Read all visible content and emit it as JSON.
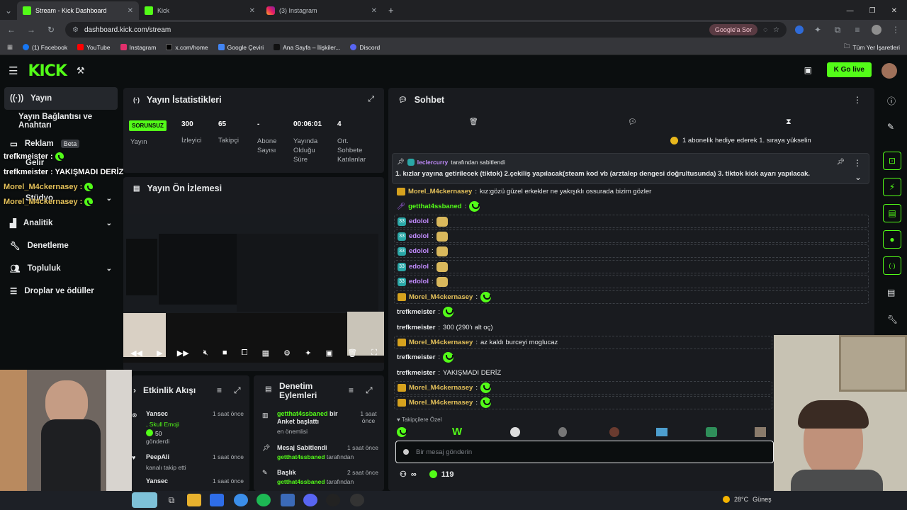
{
  "browser": {
    "tabs": [
      {
        "title": "Stream - Kick Dashboard"
      },
      {
        "title": "Kick"
      },
      {
        "title": "(3) Instagram"
      }
    ],
    "url": "dashboard.kick.com/stream",
    "google_pill": "Google'a Sor",
    "bookmarks": [
      "(1) Facebook",
      "YouTube",
      "Instagram",
      "x.com/home",
      "Google Çeviri",
      "Ana Sayfa – İlişkiler...",
      "Discord"
    ],
    "all_bookmarks": "Tüm Yer İşaretleri"
  },
  "header": {
    "logo": "KICK",
    "go_live": "Go live"
  },
  "sidebar": {
    "items": [
      {
        "label": "Yayın"
      },
      {
        "label": "Yayın Bağlantısı ve Anahtarı"
      },
      {
        "label": "Reklam",
        "badge": "Beta"
      },
      {
        "label": "Gelir"
      },
      {
        "label": "Stüdyo"
      },
      {
        "label": "Analitik"
      },
      {
        "label": "Denetleme"
      },
      {
        "label": "Topluluk"
      },
      {
        "label": "Droplar ve ödüller"
      }
    ],
    "overlay": {
      "line1": "trefkmeister :",
      "line2": "trefkmeister : YAKIŞMADI DERİZ",
      "line3": "Morel_M4ckernasey :",
      "line4": "Morel_M4ckernasey :"
    }
  },
  "stats": {
    "title": "Yayın İstatistikleri",
    "status": "SORUNSUZ",
    "status_label": "Yayın",
    "items": [
      {
        "value": "300",
        "label": "İzleyici"
      },
      {
        "value": "65",
        "label": "Takipçi"
      },
      {
        "value": "-",
        "label": "Abone Sayısı"
      },
      {
        "value": "00:06:01",
        "label": "Yayında Olduğu Süre"
      },
      {
        "value": "4",
        "label": "Ort. Sohbete Katılanlar"
      }
    ]
  },
  "preview": {
    "title": "Yayın Ön İzlemesi"
  },
  "activity": {
    "title": "Etkinlik Akışı",
    "items": [
      {
        "user": "Yansec",
        "time": "1 saat önce",
        "detail": ", Skull Emoji",
        "amount": "50",
        "action": "gönderdi"
      },
      {
        "user": "PeepAli",
        "time": "1 saat önce",
        "action": "kanalı takip etti"
      },
      {
        "user": "Yansec",
        "time": "1 saat önce"
      }
    ]
  },
  "moderation": {
    "title": "Denetim Eylemleri",
    "items": [
      {
        "user": "getthat4ssbaned",
        "text": "bir Anket başlattı",
        "sub": "en önemlisi",
        "time": "1 saat önce"
      },
      {
        "title": "Mesaj Sabitlendi",
        "user": "getthat4ssbaned",
        "suffix": "tarafından",
        "time": "1 saat önce"
      },
      {
        "title": "Başlık",
        "user": "getthat4ssbaned",
        "suffix": "tarafından",
        "time": "2 saat önce"
      }
    ]
  },
  "chat": {
    "title": "Sohbet",
    "gift_banner": "1 abonelik hediye ederek 1. sıraya yükselin",
    "pinned_by_user": "leclercurry",
    "pinned_by_suffix": "tarafından sabitlendi",
    "pinned_text": "1. kızlar yayına getirilecek (tiktok) 2.çekiliş yapılacak(steam kod vb (arztalep dengesi doğrultusunda) 3. tiktok kick ayarı yapılacak.",
    "messages": [
      {
        "user": "Morel_M4ckernasey",
        "text": "kız:gözü güzel erkekler ne yakışıklı ossurada bizim gözler"
      },
      {
        "user": "getthat4ssbaned",
        "text": ""
      },
      {
        "user": "edolol",
        "text": ""
      },
      {
        "user": "edolol",
        "text": ""
      },
      {
        "user": "edolol",
        "text": ""
      },
      {
        "user": "edolol",
        "text": ""
      },
      {
        "user": "edolol",
        "text": ""
      },
      {
        "user": "Morel_M4ckernasey",
        "text": ""
      },
      {
        "user": "trefkmeister",
        "text": ""
      },
      {
        "user": "trefkmeister",
        "text": "300 (290'ı alt oç)"
      },
      {
        "user": "Morel_M4ckernasey",
        "text": "az kaldı burceyi moglucaz"
      },
      {
        "user": "trefkmeister",
        "text": ""
      },
      {
        "user": "trefkmeister",
        "text": "YAKIŞMADI DERİZ"
      },
      {
        "user": "Morel_M4ckernasey",
        "text": ""
      },
      {
        "user": "Morel_M4ckernasey",
        "text": ""
      }
    ],
    "followers_only": "Takipçilere Özel",
    "input_placeholder": "Bir mesaj gönderin",
    "points": "119",
    "infinite": "∞"
  },
  "taskbar": {
    "weather": "28°C",
    "weather_text": "Güneş"
  },
  "colors": {
    "brand": "#53fc18",
    "bg": "#0b0e0f",
    "panel": "#191b1f",
    "gold": "#d6a21e",
    "purple": "#c38cff"
  }
}
